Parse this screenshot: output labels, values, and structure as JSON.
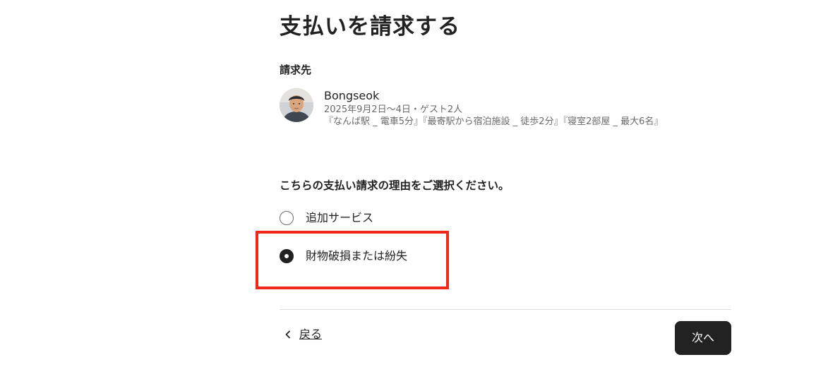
{
  "page": {
    "title": "支払いを請求する"
  },
  "billing": {
    "label": "請求先",
    "guest": {
      "name": "Bongseok",
      "stay_details": "2025年9月2日〜4日・ゲスト2人",
      "listing": "『なんば駅 _ 電車5分』『最寄駅から宿泊施設 _ 徒歩2分』『寝室2部屋 _ 最大6名』",
      "avatar_icon": "user-photo"
    }
  },
  "reason": {
    "question": "こちらの支払い請求の理由をご選択ください。",
    "options": [
      {
        "label": "追加サービス",
        "selected": false
      },
      {
        "label": "財物破損または紛失",
        "selected": true
      }
    ],
    "highlight_color": "#f0281a"
  },
  "footer": {
    "back_label": "戻る",
    "back_icon": "chevron-left-icon",
    "next_label": "次へ"
  }
}
